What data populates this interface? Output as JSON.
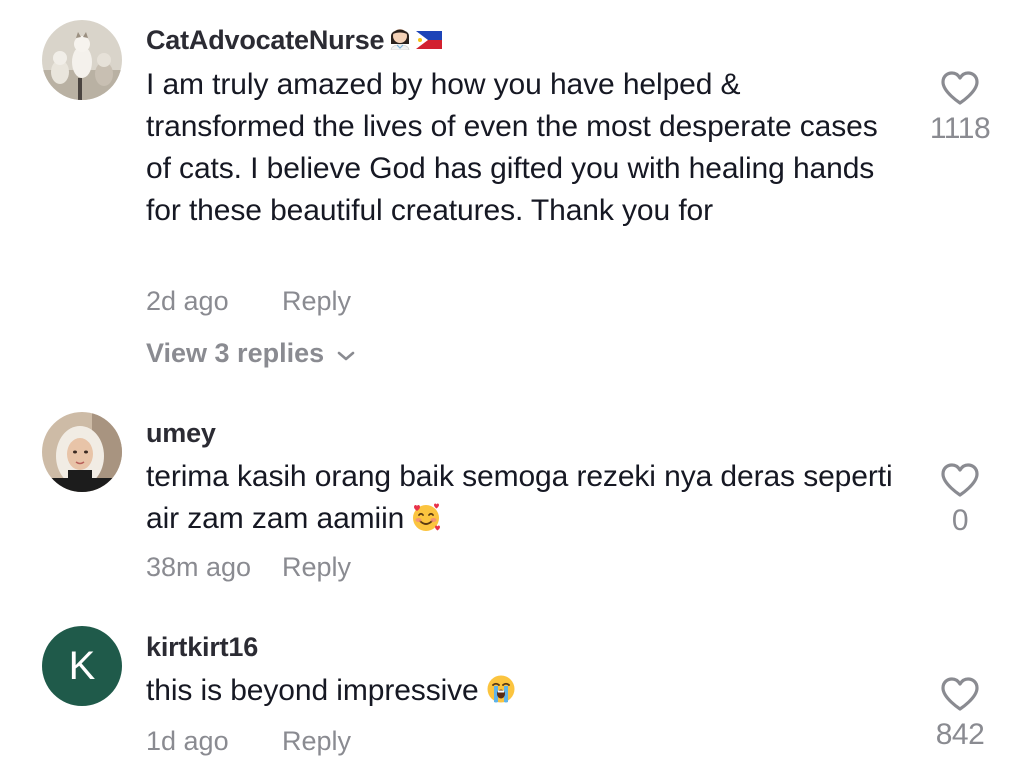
{
  "comments": [
    {
      "username": "CatAdvocateNurse",
      "text": "I am truly amazed by how you have helped & transformed the lives of even the most desperate cases of cats. I believe God has gifted you with healing hands for these beautiful creatures. Thank you for",
      "time": "2d ago",
      "reply_label": "Reply",
      "likes": "1118",
      "view_replies": "View 3 replies",
      "avatar": "cats-photo",
      "badges": [
        "woman-health-worker-emoji",
        "philippines-flag-emoji"
      ]
    },
    {
      "username": "umey",
      "text": "terima kasih orang baik semoga rezeki nya deras seperti air zam zam aamiin",
      "emoji": "smiling-face-with-hearts-emoji",
      "time": "38m ago",
      "reply_label": "Reply",
      "likes": "0",
      "avatar": "woman-hijab-photo"
    },
    {
      "username": "kirtkirt16",
      "text": "this is beyond impressive",
      "emoji": "loudly-crying-face-emoji",
      "time": "1d ago",
      "reply_label": "Reply",
      "likes": "842",
      "avatar_letter": "K",
      "avatar_color": "#1f5a4a"
    }
  ],
  "colors": {
    "primary_text": "#161823",
    "secondary_text": "#8a8b91"
  }
}
